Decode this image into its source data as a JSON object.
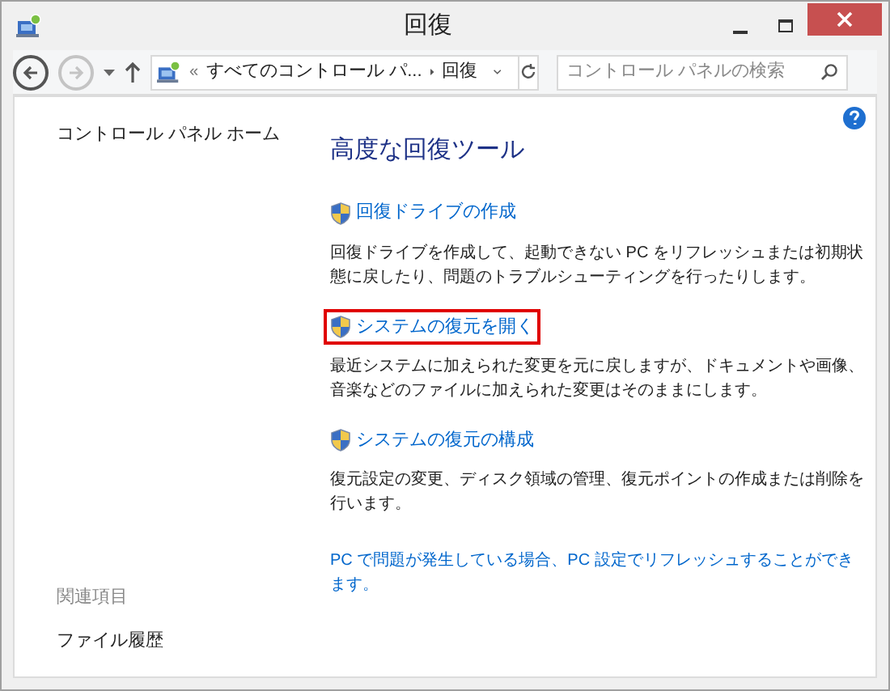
{
  "window": {
    "title": "回復"
  },
  "address_bar": {
    "overflow": "«",
    "path": [
      {
        "label": "すべてのコントロール パ..."
      },
      {
        "label": "回復"
      }
    ]
  },
  "search": {
    "placeholder": "コントロール パネルの検索"
  },
  "sidebar": {
    "home_link": "コントロール パネル ホーム",
    "see_also_heading": "関連項目",
    "see_also_items": [
      "ファイル履歴"
    ]
  },
  "main": {
    "heading": "高度な回復ツール",
    "tools": [
      {
        "title": "回復ドライブの作成",
        "description": "回復ドライブを作成して、起動できない PC をリフレッシュまたは初期状態に戻したり、問題のトラブルシューティングを行ったりします。",
        "highlighted": false
      },
      {
        "title": "システムの復元を開く",
        "description": "最近システムに加えられた変更を元に戻しますが、ドキュメントや画像、音楽などのファイルに加えられた変更はそのままにします。",
        "highlighted": true
      },
      {
        "title": "システムの復元の構成",
        "description": "復元設定の変更、ディスク領域の管理、復元ポイントの作成または削除を行います。",
        "highlighted": false
      }
    ],
    "footer_link": "PC で問題が発生している場合、PC 設定でリフレッシュすることができます。"
  }
}
